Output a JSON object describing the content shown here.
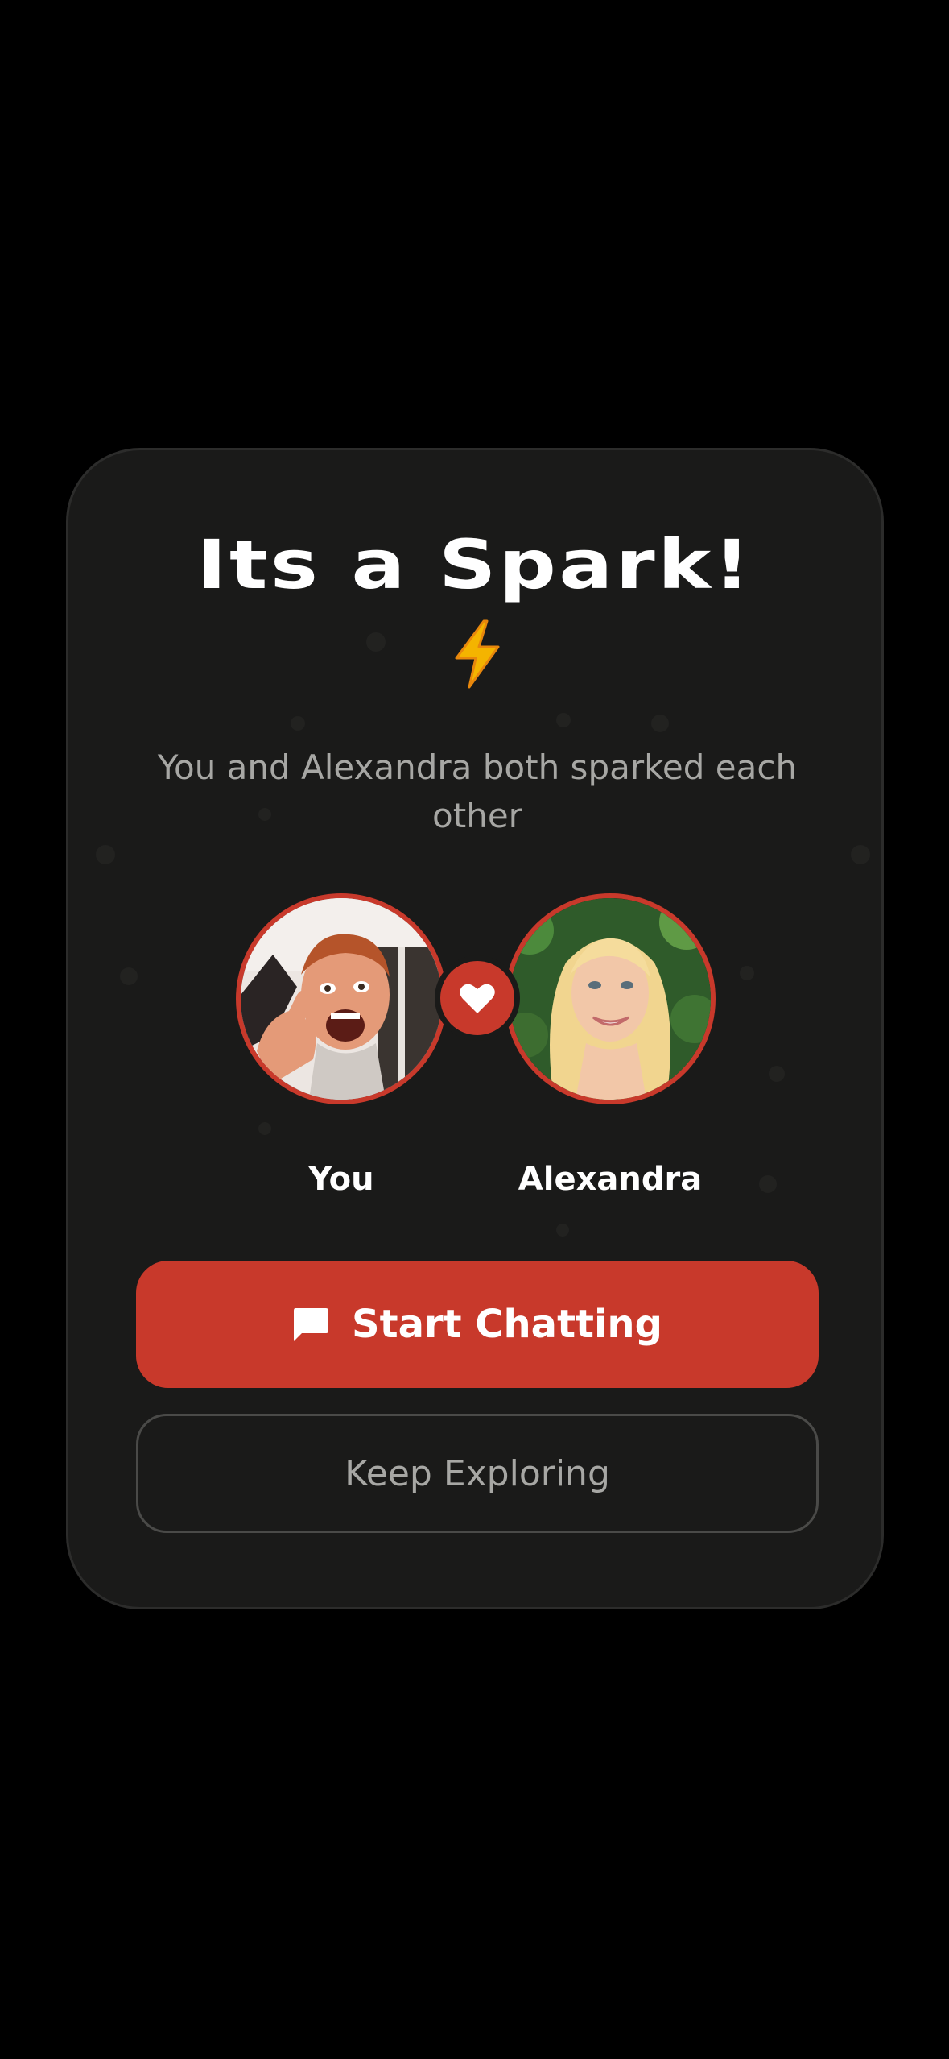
{
  "match_modal": {
    "title": "Its a Spark!",
    "title_emoji_icon": "lightning-bolt-icon",
    "subtitle": "You and Alexandra both sparked each other",
    "you": {
      "label": "You",
      "avatar": "user-photo"
    },
    "match": {
      "label": "Alexandra",
      "avatar": "match-photo"
    },
    "badge_icon": "heart-icon",
    "primary_button": {
      "label": "Start Chatting",
      "icon": "chat-bubble-icon"
    },
    "secondary_button": {
      "label": "Keep Exploring"
    }
  },
  "colors": {
    "background": "#000000",
    "card": "#1a1a19",
    "accent": "#c8392b",
    "text_primary": "#ffffff",
    "text_muted": "#a7a7a4"
  }
}
